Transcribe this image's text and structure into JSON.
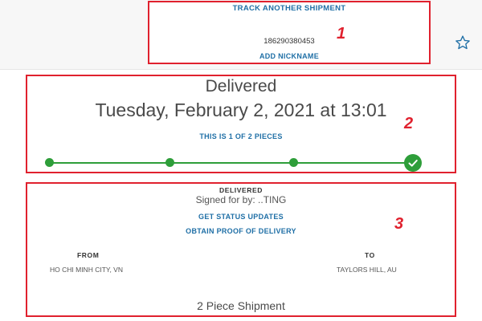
{
  "header": {
    "track_another": "TRACK ANOTHER SHIPMENT",
    "tracking_number": "186290380453",
    "add_nickname": "ADD NICKNAME"
  },
  "annotations": [
    "1",
    "2",
    "3"
  ],
  "status": {
    "title": "Delivered",
    "datetime": "Tuesday, February 2, 2021 at 13:01",
    "pieces_link": "THIS IS 1 OF 2 PIECES",
    "progress_steps": 4,
    "progress_complete": 4
  },
  "details": {
    "delivered_label": "DELIVERED",
    "signed_for": "Signed for by: ..TING",
    "get_status_updates": "GET STATUS UPDATES",
    "proof_of_delivery": "OBTAIN PROOF OF DELIVERY",
    "from_label": "FROM",
    "from_value": "HO CHI MINH CITY, VN",
    "to_label": "TO",
    "to_value": "TAYLORS HILL, AU",
    "shipment_summary": "2 Piece Shipment"
  },
  "colors": {
    "annotation_red": "#e0212e",
    "link_blue": "#1f6fa6",
    "progress_green": "#2e9e3a"
  },
  "icons": {
    "star": "star-outline-icon",
    "check": "checkmark-icon"
  }
}
